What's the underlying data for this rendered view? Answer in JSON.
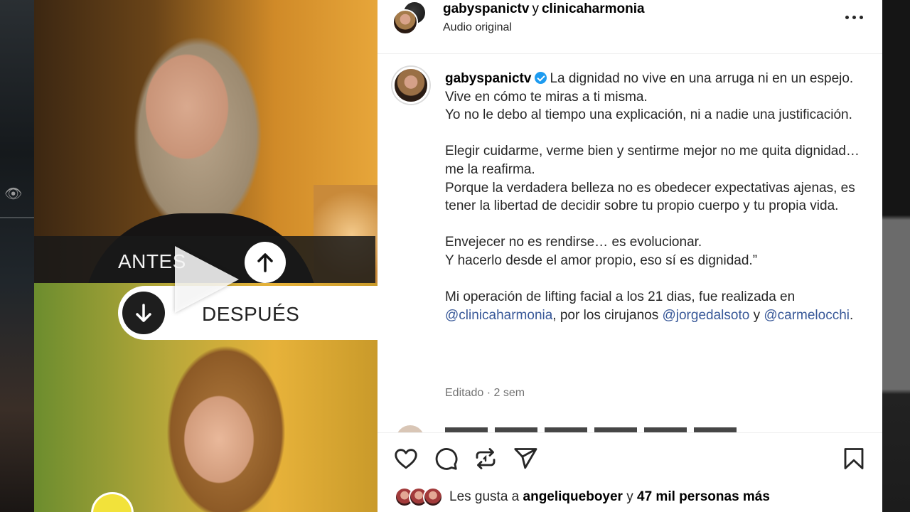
{
  "media": {
    "label_before": "ANTES",
    "label_after": "DESPUÉS",
    "icons": [
      "arrow-up-icon",
      "arrow-down-icon",
      "play-icon"
    ]
  },
  "header": {
    "user1": "gabyspanictv",
    "joiner": "y",
    "user2": "clinicaharmonia",
    "subtitle": "Audio original",
    "more_icon": "more-horizontal-icon"
  },
  "caption": {
    "username": "gabyspanictv",
    "lines": [
      "La dignidad no vive en una arruga ni en un espejo. Vive en cómo te miras a ti misma.",
      "Yo no le debo al tiempo una explicación, ni a nadie una justificación.",
      "",
      "Elegir cuidarme, verme bien y sentirme mejor no me quita dignidad… me la reafirma.",
      "Porque la verdadera belleza no es obedecer expectativas ajenas, es tener la libertad de decidir sobre tu propio cuerpo y tu propia vida.",
      "",
      "Envejecer no es rendirse… es evolucionar.",
      "Y hacerlo desde el amor propio, eso sí es dignidad.”",
      ""
    ],
    "final_pre": "Mi operación de lifting facial a los 21 dias, fue realizada en ",
    "mention1": "@clinicaharmonia",
    "final_mid": ", por los cirujanos ",
    "mention2": "@jorgedalsoto",
    "final_and": " y ",
    "mention3": "@carmelocchi",
    "final_end": ".",
    "meta": "Editado · 2 sem"
  },
  "actions": {
    "like_icon": "heart-icon",
    "comment_icon": "comment-icon",
    "repost_icon": "repost-icon",
    "share_icon": "send-icon",
    "save_icon": "bookmark-icon"
  },
  "likes": {
    "prefix": "Les gusta a ",
    "user": "angeliqueboyer",
    "mid": " y ",
    "count": "47 mil personas más"
  },
  "colors": {
    "mention": "#385898",
    "verified": "#1d9bf0",
    "meta": "#737373"
  }
}
